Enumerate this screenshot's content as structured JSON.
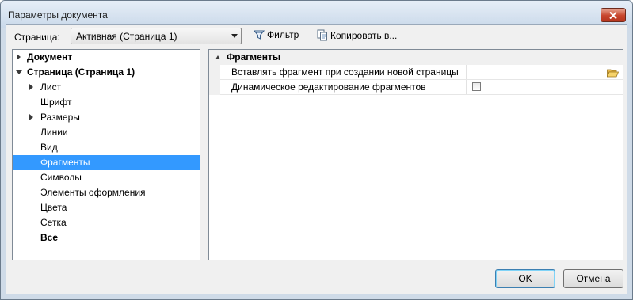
{
  "window": {
    "title": "Параметры документа"
  },
  "toolbar": {
    "page_label": "Страница:",
    "page_select_value": "Активная (Страница 1)",
    "filter_label": "Фильтр",
    "copy_label": "Копировать в..."
  },
  "tree": {
    "items": [
      {
        "label": "Документ",
        "bold": true,
        "expander": "collapsed",
        "level": 0
      },
      {
        "label": "Страница (Страница 1)",
        "bold": true,
        "expander": "expanded",
        "level": 0
      },
      {
        "label": "Лист",
        "bold": false,
        "expander": "collapsed",
        "level": 1
      },
      {
        "label": "Шрифт",
        "bold": false,
        "expander": "none",
        "level": 1
      },
      {
        "label": "Размеры",
        "bold": false,
        "expander": "collapsed",
        "level": 1
      },
      {
        "label": "Линии",
        "bold": false,
        "expander": "none",
        "level": 1
      },
      {
        "label": "Вид",
        "bold": false,
        "expander": "none",
        "level": 1
      },
      {
        "label": "Фрагменты",
        "bold": false,
        "expander": "none",
        "level": 1,
        "selected": true
      },
      {
        "label": "Символы",
        "bold": false,
        "expander": "none",
        "level": 1
      },
      {
        "label": "Элементы оформления",
        "bold": false,
        "expander": "none",
        "level": 1
      },
      {
        "label": "Цвета",
        "bold": false,
        "expander": "none",
        "level": 1
      },
      {
        "label": "Сетка",
        "bold": false,
        "expander": "none",
        "level": 1
      },
      {
        "label": "Все",
        "bold": true,
        "expander": "none",
        "level": 1
      }
    ]
  },
  "properties": {
    "category": "Фрагменты",
    "rows": [
      {
        "name": "Вставлять фрагмент при создании новой страницы",
        "editor": "folder-icon"
      },
      {
        "name": "Динамическое редактирование фрагментов",
        "editor": "checkbox",
        "checked": false
      }
    ]
  },
  "buttons": {
    "ok": "OK",
    "cancel": "Отмена"
  },
  "colors": {
    "selection": "#3399ff",
    "close_button": "#c7452c"
  }
}
